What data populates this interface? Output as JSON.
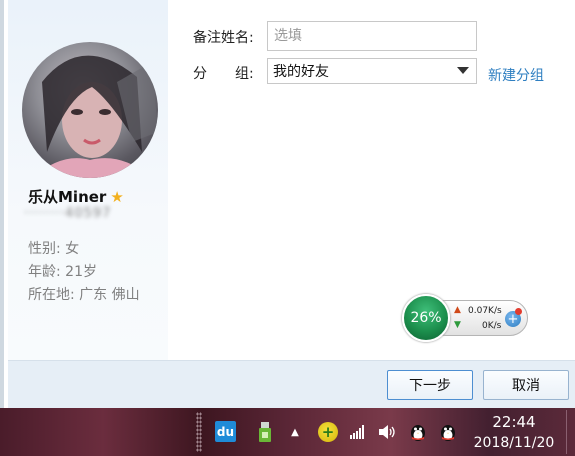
{
  "dialog": {
    "profile": {
      "nickname": "乐从Miner",
      "qq_number_masked": "········40597",
      "gender": "性别: 女",
      "age": "年龄: 21岁",
      "location": "所在地: 广东  佛山"
    },
    "form": {
      "remark_label": "备注姓名:",
      "remark_placeholder": "选填",
      "group_label": "分　　组:",
      "group_selected": "我的好友",
      "new_group_link": "新建分组"
    },
    "buttons": {
      "next": "下一步",
      "cancel": "取消"
    }
  },
  "speed_widget": {
    "percent": "26%",
    "upload": "0.07K/s",
    "download": "0K/s"
  },
  "taskbar": {
    "du_label": "du",
    "time": "22:44",
    "date": "2018/11/20"
  },
  "colors": {
    "link": "#2f7fc1",
    "star": "#f2b01e",
    "speed_ball": "#1c8f4d"
  }
}
